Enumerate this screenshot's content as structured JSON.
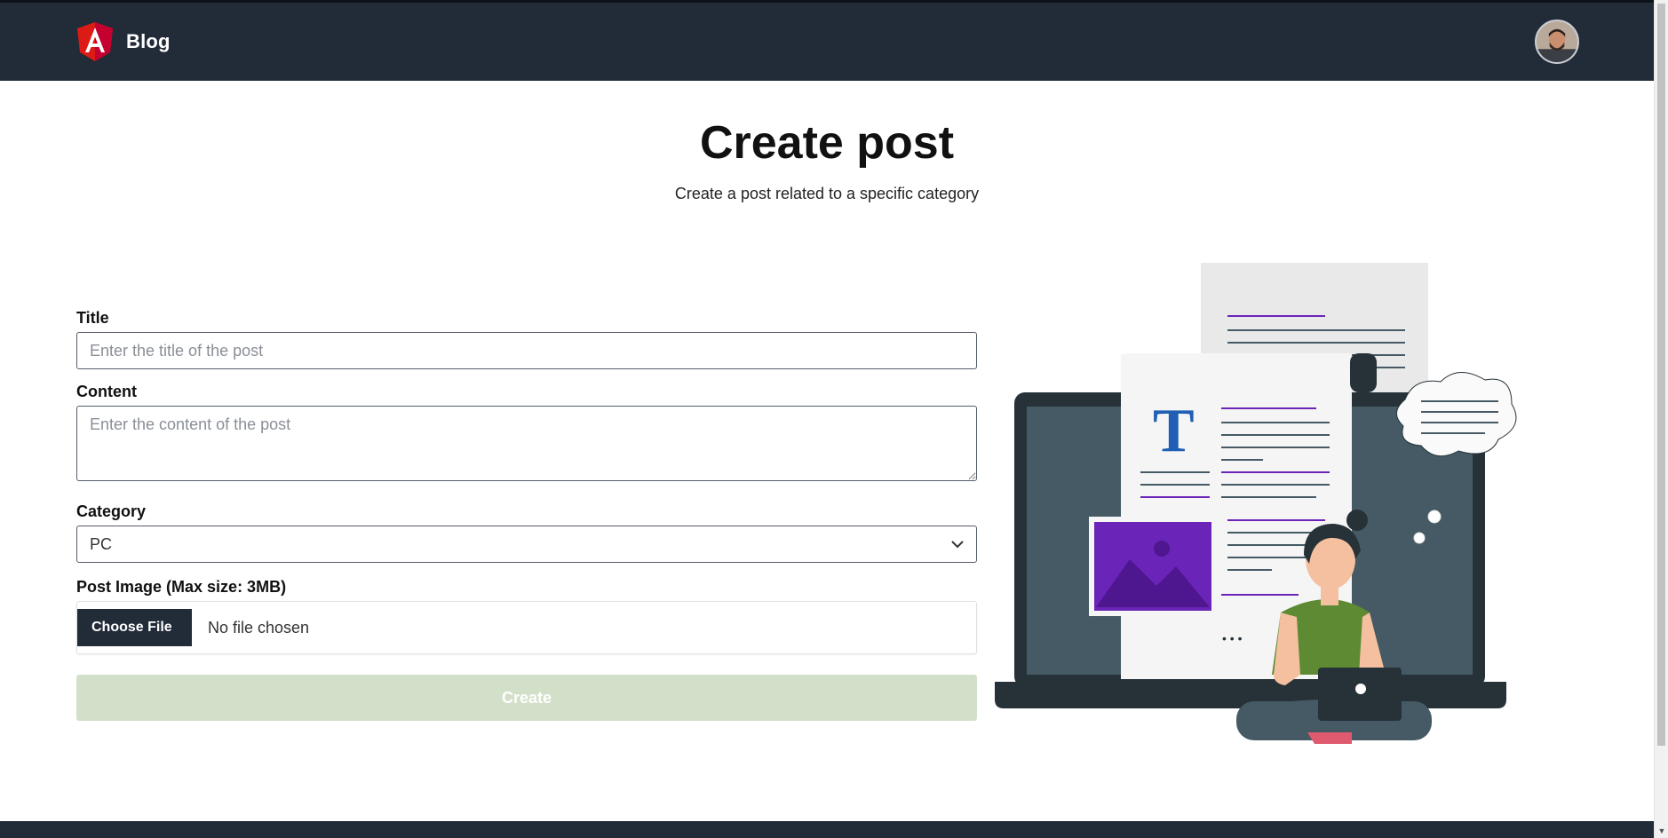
{
  "navbar": {
    "brand_name": "Blog",
    "logo_icon": "angular-logo-icon",
    "avatar_icon": "user-avatar"
  },
  "header": {
    "title": "Create post",
    "subtitle": "Create a post related to a specific category"
  },
  "form": {
    "title_label": "Title",
    "title_placeholder": "Enter the title of the post",
    "title_value": "",
    "content_label": "Content",
    "content_placeholder": "Enter the content of the post",
    "content_value": "",
    "category_label": "Category",
    "category_value": "PC",
    "image_label": "Post Image (Max size: 3MB)",
    "choose_file_label": "Choose File",
    "file_status": "No file chosen",
    "submit_label": "Create"
  },
  "colors": {
    "navbar_bg": "#222b38",
    "brand_red": "#dd1b16",
    "submit_disabled": "#d3e0c9",
    "accent_purple": "#6a25b8"
  },
  "illustration": {
    "doc_letter": "T",
    "ellipsis": "• • •"
  }
}
